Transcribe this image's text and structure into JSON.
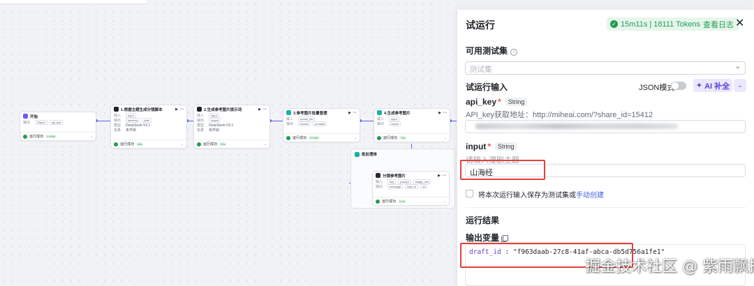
{
  "canvas": {
    "nodes": {
      "start": {
        "title": "开始",
        "row_key": "输出",
        "chips": [
          "Object",
          "api_key"
        ],
        "status": "运行成功",
        "time": "0.000s"
      },
      "script": {
        "title": "1.根据主题生成分镜脚本",
        "rows": [
          {
            "key": "输入",
            "chips": [
              "input"
            ]
          },
          {
            "key": "输出",
            "chips": [
              "faceKey",
              "jobs"
            ]
          },
          {
            "key": "模型",
            "chips": [
              "DeepSeek-V3.1"
            ]
          },
          {
            "key": "批量",
            "chips": [
              "未开启"
            ]
          }
        ],
        "status": "运行成功",
        "time": "48s"
      },
      "prompt": {
        "title": "2.生成参考图片提示词",
        "rows": [
          {
            "key": "输入",
            "chips": [
              "input"
            ]
          },
          {
            "key": "输出",
            "chips": [
              "output"
            ]
          },
          {
            "key": "模型",
            "chips": [
              "DeepSeek-V3.1"
            ]
          },
          {
            "key": "批量",
            "chips": [
              "未开启"
            ]
          }
        ],
        "status": "运行成功",
        "time": "20s"
      },
      "ref_img": {
        "title": "3.参考图片批量管理",
        "rows": [
          {
            "key": "输入",
            "chips": [
              "model_list"
            ]
          },
          {
            "key": "输出",
            "chips": [
              "names",
              "prompts"
            ]
          }
        ],
        "status": "运行成功",
        "time": "0.000s"
      },
      "gen_ref": {
        "title": "4.生成参考图片",
        "rows": [
          {
            "key": "输入",
            "chips": [
              "input"
            ]
          },
          {
            "key": "输出",
            "chips": [
              "output"
            ]
          }
        ],
        "status": "运行成功",
        "time": "10s"
      },
      "loop": {
        "title": "批处理体"
      },
      "batch_img": {
        "title": "分镜参考图片",
        "rows": [
          {
            "key": "输入",
            "chips": [
              "key",
              "prompt",
              "image_urls"
            ]
          },
          {
            "key": "输出",
            "chips": [
              "message",
              "task_id",
              "url"
            ]
          }
        ],
        "status": "运行成功",
        "time": "0.5s"
      }
    }
  },
  "panel": {
    "title": "试运行",
    "status": "15m11s | 18111 Tokens",
    "view_log": "查看日志",
    "testset_title": "可用测试集",
    "testset_placeholder": "测试集",
    "input_title": "试运行输入",
    "json_mode": "JSON模式",
    "ai_fill": "AI 补全",
    "api_key": {
      "name": "api_key",
      "type": "String",
      "desc": "API_key获取地址：http://miheai.com/?share_id=15412"
    },
    "input": {
      "name": "input",
      "type": "String",
      "placeholder_desc": "请输入漫剧主题",
      "value": "山海经"
    },
    "save_checkbox": "将本次运行输入保存为测试集或",
    "save_link": "手动创建",
    "result_title": "运行结果",
    "output_title": "输出变量",
    "output_key": "draft_id",
    "output_sep": " : ",
    "output_value": "\"f963daab-27c8-41af-abca-db5d756a1fe1\""
  },
  "watermark": "掘金技术社区 @ 紫雨飘扬",
  "colors": {
    "accent": "#5b5ef5",
    "success": "#1f9e4f",
    "highlight": "#e5403b",
    "ai": "#5b3fd9"
  }
}
